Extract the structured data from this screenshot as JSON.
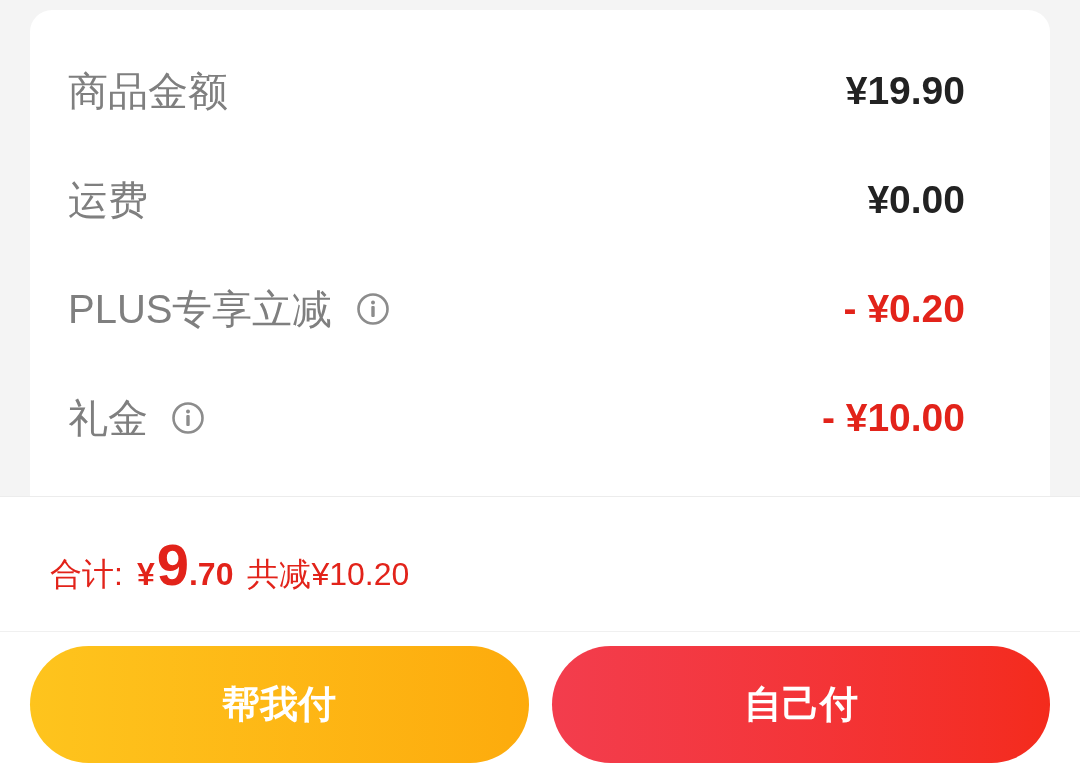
{
  "summary_rows": [
    {
      "label": "商品金额",
      "value": "¥19.90",
      "kind": "amount",
      "has_info": false
    },
    {
      "label": "运费",
      "value": "¥0.00",
      "kind": "amount",
      "has_info": false
    },
    {
      "label": "PLUS专享立减",
      "value": "- ¥0.20",
      "kind": "discount",
      "has_info": true
    },
    {
      "label": "礼金",
      "value": "- ¥10.00",
      "kind": "discount",
      "has_info": true
    }
  ],
  "total": {
    "label": "合计:",
    "currency": "¥",
    "integer": "9",
    "decimal": ".70",
    "saving": "共减¥10.20"
  },
  "buttons": [
    {
      "label": "帮我付",
      "kind": "secondary"
    },
    {
      "label": "自己付",
      "kind": "primary"
    }
  ]
}
